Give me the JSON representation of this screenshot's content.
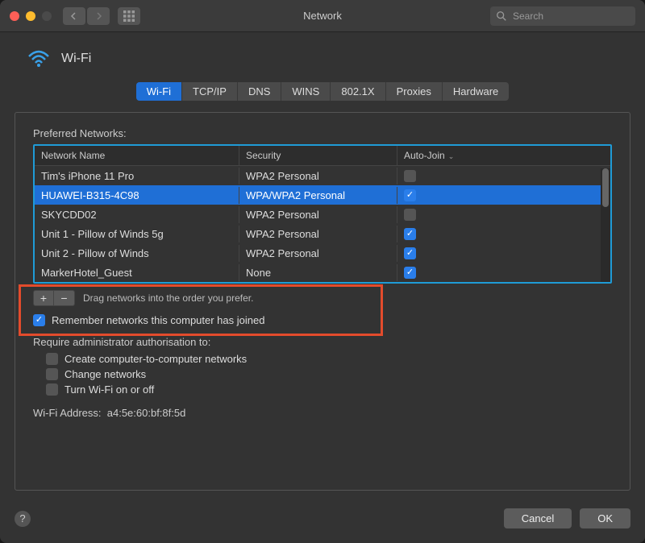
{
  "window": {
    "title": "Network",
    "search_placeholder": "Search"
  },
  "header": {
    "title": "Wi-Fi"
  },
  "tabs": [
    "Wi-Fi",
    "TCP/IP",
    "DNS",
    "WINS",
    "802.1X",
    "Proxies",
    "Hardware"
  ],
  "active_tab_index": 0,
  "preferred_label": "Preferred Networks:",
  "columns": {
    "name": "Network Name",
    "security": "Security",
    "autojoin": "Auto-Join"
  },
  "networks": [
    {
      "name": "Tim's iPhone 11 Pro",
      "security": "WPA2 Personal",
      "autojoin": false,
      "selected": false
    },
    {
      "name": "HUAWEI-B315-4C98",
      "security": "WPA/WPA2 Personal",
      "autojoin": true,
      "selected": true
    },
    {
      "name": "SKYCDD02",
      "security": "WPA2 Personal",
      "autojoin": false,
      "selected": false
    },
    {
      "name": "Unit 1 - Pillow of Winds 5g",
      "security": "WPA2 Personal",
      "autojoin": true,
      "selected": false
    },
    {
      "name": "Unit 2 - Pillow of Winds",
      "security": "WPA2 Personal",
      "autojoin": true,
      "selected": false
    },
    {
      "name": "MarkerHotel_Guest",
      "security": "None",
      "autojoin": true,
      "selected": false
    }
  ],
  "drag_hint": "Drag networks into the order you prefer.",
  "remember": {
    "label": "Remember networks this computer has joined",
    "checked": true
  },
  "require_label": "Require administrator authorisation to:",
  "require_opts": [
    {
      "label": "Create computer-to-computer networks",
      "checked": false
    },
    {
      "label": "Change networks",
      "checked": false
    },
    {
      "label": "Turn Wi-Fi on or off",
      "checked": false
    }
  ],
  "address": {
    "label": "Wi-Fi Address:",
    "value": "a4:5e:60:bf:8f:5d"
  },
  "buttons": {
    "cancel": "Cancel",
    "ok": "OK"
  },
  "plus": "+",
  "minus": "−",
  "help": "?"
}
